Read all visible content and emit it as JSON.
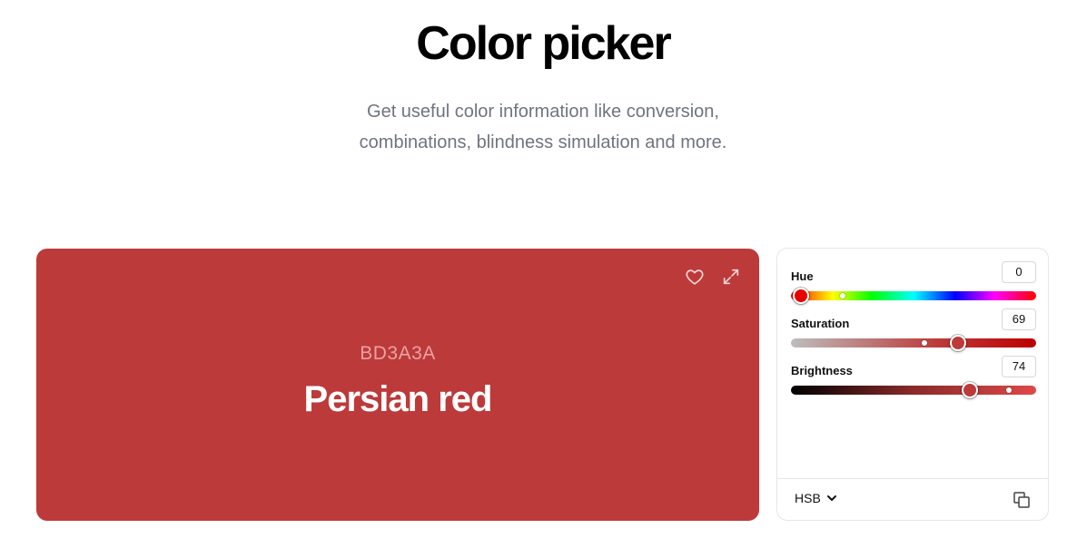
{
  "header": {
    "title": "Color picker",
    "subtitle_line1": "Get useful color information like conversion,",
    "subtitle_line2": "combinations, blindness simulation and more."
  },
  "swatch": {
    "hex": "BD3A3A",
    "name": "Persian red",
    "background_color": "#BD3A3A",
    "icons": [
      "heart-icon",
      "expand-icon"
    ]
  },
  "controls": {
    "hue": {
      "label": "Hue",
      "value": "0",
      "thumb_color": "#E60000"
    },
    "saturation": {
      "label": "Saturation",
      "value": "69",
      "thumb_color": "#BD3A3A"
    },
    "brightness": {
      "label": "Brightness",
      "value": "74",
      "thumb_color": "#BD3A3A"
    },
    "mode": "HSB",
    "icons": [
      "chevron-down-icon",
      "copy-icon"
    ]
  }
}
